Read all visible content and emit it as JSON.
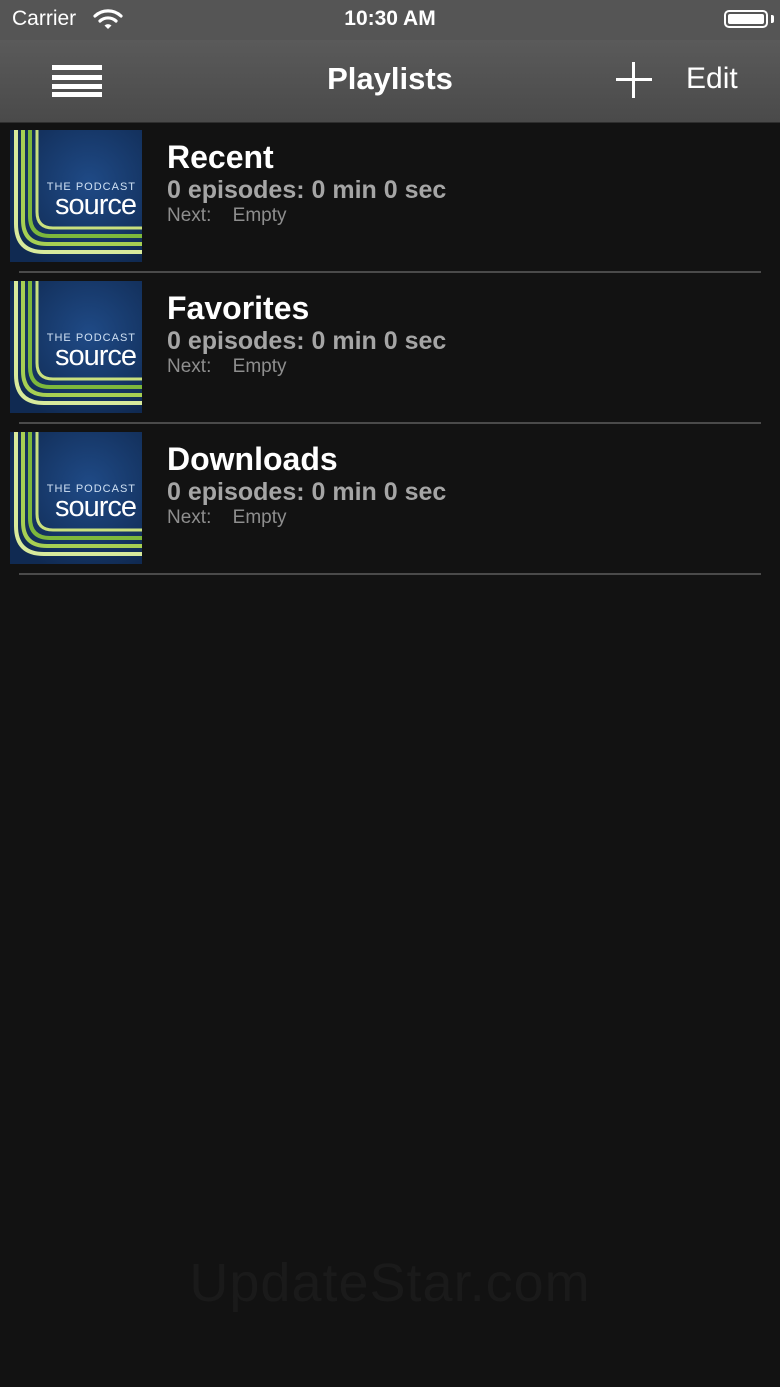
{
  "status_bar": {
    "carrier": "Carrier",
    "time": "10:30 AM"
  },
  "navbar": {
    "title": "Playlists",
    "edit_label": "Edit"
  },
  "artwork": {
    "small_text": "THE PODCAST",
    "big_text": "source"
  },
  "playlists": [
    {
      "title": "Recent",
      "summary": "0 episodes: 0 min 0 sec",
      "next_label": "Next:",
      "next_value": "Empty"
    },
    {
      "title": "Favorites",
      "summary": "0 episodes: 0 min 0 sec",
      "next_label": "Next:",
      "next_value": "Empty"
    },
    {
      "title": "Downloads",
      "summary": "0 episodes: 0 min 0 sec",
      "next_label": "Next:",
      "next_value": "Empty"
    }
  ],
  "watermark": "UpdateStar.com",
  "colors": {
    "background": "#121212",
    "navbar": "#555555",
    "artwork_blue": "#17396a",
    "artwork_green": "#8ec63f"
  }
}
